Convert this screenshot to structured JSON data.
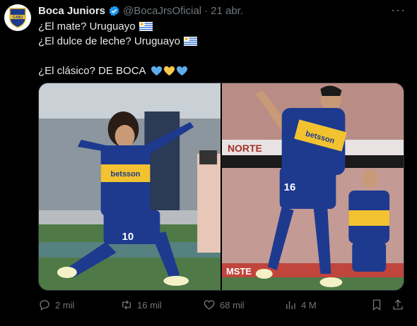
{
  "tweet": {
    "author_name": "Boca Juniors",
    "handle": "@BocaJrsOficial",
    "separator": "·",
    "date": "21 abr.",
    "more_label": "···",
    "lines": [
      "¿El mate? Uruguayo",
      "¿El dulce de leche? Uruguayo",
      "",
      "¿El clásico? DE BOCA"
    ],
    "media": [
      {
        "sponsor_text": "betsson",
        "shirt_number": "10"
      },
      {
        "sponsor_text": "betsson",
        "shirt_number": "16",
        "banner_text": "NORTE",
        "ad_text": "MSTE"
      }
    ]
  },
  "actions": {
    "replies": "2 mil",
    "reposts": "16 mil",
    "likes": "68 mil",
    "views": "4 M"
  },
  "colors": {
    "background": "#000000",
    "text": "#e7e9ea",
    "muted": "#71767b",
    "verified": "#1d9bf0",
    "boca_blue": "#1d3a8f",
    "boca_gold": "#f2c230"
  },
  "icons": [
    "boca-crest-icon",
    "verified-icon",
    "more-icon",
    "uruguay-flag-icon",
    "blue-heart-icon",
    "yellow-heart-icon",
    "reply-icon",
    "repost-icon",
    "like-icon",
    "views-icon",
    "bookmark-icon",
    "share-icon"
  ]
}
